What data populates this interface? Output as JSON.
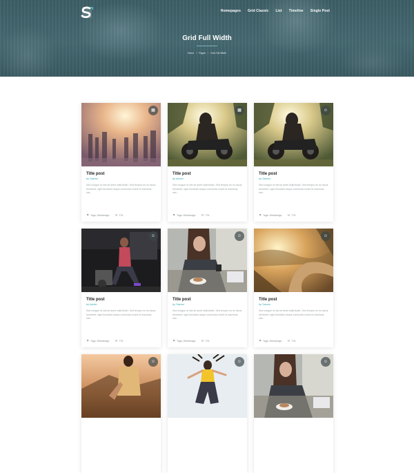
{
  "nav": {
    "items": [
      "Homepages",
      "Grid Classic",
      "List",
      "Timeline",
      "Single Post"
    ]
  },
  "hero": {
    "title": "Grid Full Width",
    "breadcrumb": [
      "Home",
      "Pages",
      "Grid Full Width"
    ],
    "separator": "/"
  },
  "posts": [
    {
      "title": "Title post",
      "by": "by",
      "author": "Saemo",
      "excerpt": "Sed congue id nisl sit amet sollicitudin. Sed tempor eu eu lacus hendrerit, eget tincidunt neque commodo morbi id maximus nisi...",
      "tags": "Tags: Webdesign",
      "comments": "776",
      "badge": "gallery-icon"
    },
    {
      "title": "Title post",
      "by": "by",
      "author": "Admin",
      "excerpt": "Sed congue id nisl sit amet sollicitudin. Sed tempor eu eu lacus hendrerit, eget tincidunt neque commodo morbi id maximus nisi...",
      "tags": "Tags: Webdesign",
      "comments": "776",
      "badge": "gallery-icon"
    },
    {
      "title": "Title post",
      "by": "by",
      "author": "Saemo",
      "excerpt": "Sed congue id nisl sit amet sollicitudin. Sed tempor eu eu lacus hendrerit, eget tincidunt neque commodo morbi id maximus nisi...",
      "tags": "Tags: Webdesign",
      "comments": "776",
      "badge": "user-icon"
    },
    {
      "title": "Title post",
      "by": "by",
      "author": "Admin",
      "excerpt": "Sed congue id nisl sit amet sollicitudin. Sed tempor eu eu lacus hendrerit, eget tincidunt neque commodo morbi id maximus nisi...",
      "tags": "Tags: Webdesign",
      "comments": "776",
      "badge": "user-icon"
    },
    {
      "title": "Title post",
      "by": "by",
      "author": "Saemo",
      "excerpt": "Sed congue id nisl sit amet sollicitudin. Sed tempor eu eu lacus hendrerit, eget tincidunt neque commodo morbi id maximus nisi...",
      "tags": "Tags: Webdesign",
      "comments": "776",
      "badge": "user-icon"
    },
    {
      "title": "Title post",
      "by": "by",
      "author": "Saemo",
      "excerpt": "Sed congue id nisl sit amet sollicitudin. Sed tempor eu eu lacus hendrerit, eget tincidunt neque commodo morbi id maximus nisi...",
      "tags": "Tags: Webdesign",
      "comments": "776",
      "badge": "user-icon"
    },
    {
      "title": "",
      "by": "",
      "author": "",
      "excerpt": "",
      "tags": "",
      "comments": "",
      "badge": "user-icon"
    },
    {
      "title": "",
      "by": "",
      "author": "",
      "excerpt": "",
      "tags": "",
      "comments": "",
      "badge": "user-icon"
    },
    {
      "title": "",
      "by": "",
      "author": "",
      "excerpt": "",
      "tags": "",
      "comments": "",
      "badge": "user-icon"
    }
  ],
  "colors": {
    "accent": "#3aa7b1",
    "hero": "#456870"
  }
}
